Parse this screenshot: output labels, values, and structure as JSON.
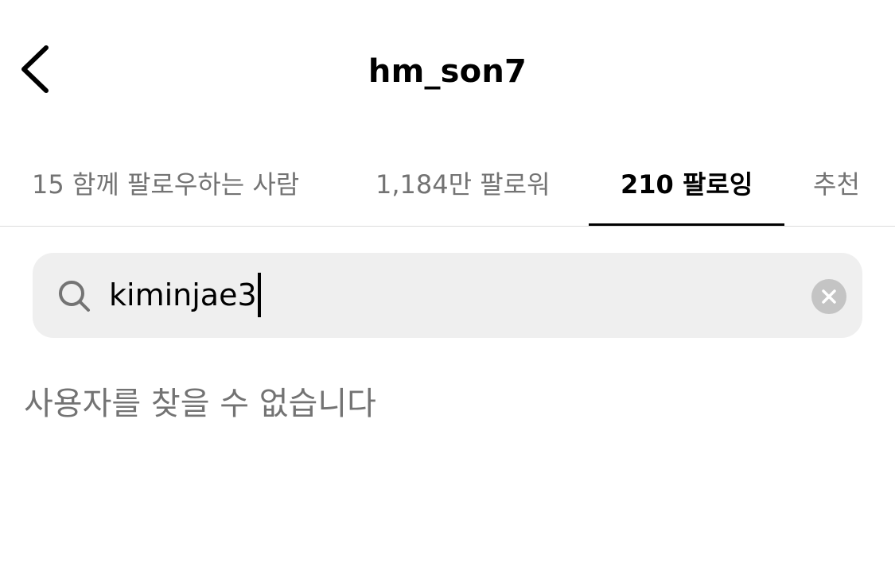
{
  "header": {
    "title": "hm_son7",
    "back_icon": "chevron-left-icon"
  },
  "tabs": [
    {
      "label": "15 함께 팔로우하는 사람",
      "active": false
    },
    {
      "label": "1,184만 팔로워",
      "active": false
    },
    {
      "label": "210 팔로잉",
      "active": true
    },
    {
      "label": "추천",
      "active": false
    }
  ],
  "search": {
    "value": "kiminjae3",
    "icon": "search-icon",
    "clear_icon": "clear-icon"
  },
  "results": {
    "empty_message": "사용자를 찾을 수 없습니다"
  },
  "colors": {
    "text_primary": "#000000",
    "text_secondary": "#737373",
    "search_bg": "#efefef",
    "divider": "#dbdbdb"
  }
}
